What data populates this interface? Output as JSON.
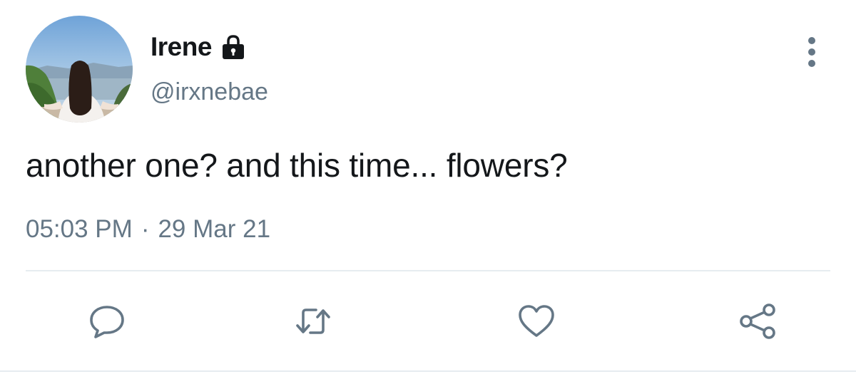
{
  "tweet": {
    "author_name": "Irene",
    "author_handle": "@irxnebae",
    "text": "another one? and this time... flowers?",
    "time": "05:03 PM",
    "separator": "·",
    "date": "29 Mar 21"
  },
  "icons": {
    "lock": "lock-icon",
    "more": "more-vertical-icon",
    "reply": "reply-icon",
    "retweet": "retweet-icon",
    "like": "heart-icon",
    "share": "share-icon"
  },
  "colors": {
    "text_primary": "#14171a",
    "text_secondary": "#657786",
    "icon": "#657786",
    "divider": "#e6ecf0"
  }
}
